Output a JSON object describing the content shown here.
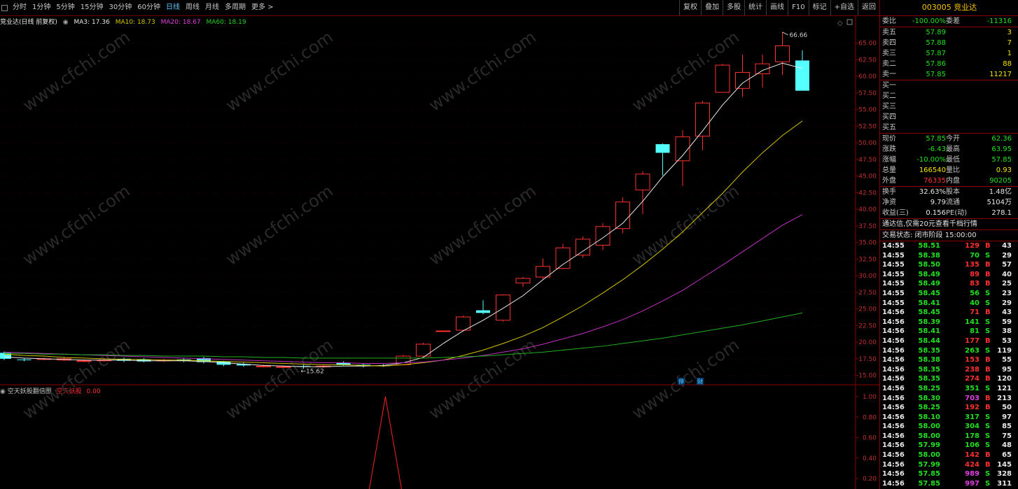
{
  "toolbar": {
    "tabs": [
      {
        "label": "分时",
        "active": false
      },
      {
        "label": "1分钟",
        "active": false
      },
      {
        "label": "5分钟",
        "active": false
      },
      {
        "label": "15分钟",
        "active": false
      },
      {
        "label": "30分钟",
        "active": false
      },
      {
        "label": "60分钟",
        "active": false
      },
      {
        "label": "日线",
        "active": true
      },
      {
        "label": "周线",
        "active": false
      },
      {
        "label": "月线",
        "active": false
      },
      {
        "label": "多周期",
        "active": false
      },
      {
        "label": "更多 >",
        "active": false
      }
    ],
    "right_buttons": [
      "复权",
      "叠加",
      "多股",
      "统计",
      "画线",
      "F10",
      "标记",
      "+自选",
      "返回"
    ]
  },
  "chart_header": {
    "name": "竞业达(日线 前复权)",
    "ma3": "MA3: 17.36",
    "ma10": "MA10: 18.73",
    "ma20": "MA20: 18.67",
    "ma60": "MA60: 18.19"
  },
  "indicator": {
    "title": "空天妖股翻倍图",
    "label": "空天妖股",
    "value": "0.00",
    "axis": [
      "1.00",
      "0.80",
      "0.60",
      "0.40",
      "0.20"
    ]
  },
  "price_axis": [
    "65.00",
    "62.50",
    "60.00",
    "57.50",
    "55.00",
    "52.50",
    "50.00",
    "47.50",
    "45.00",
    "42.50",
    "40.00",
    "37.50",
    "35.00",
    "32.50",
    "30.00",
    "27.50",
    "25.00",
    "22.50",
    "20.00",
    "17.50",
    "15.00"
  ],
  "annotations": {
    "high": "66.66",
    "low": "15.62",
    "event1": "停",
    "event2": "财"
  },
  "chart_data": {
    "type": "candlestick",
    "ylim": [
      13.8,
      67.5
    ],
    "candles": [
      {
        "o": 18.4,
        "c": 17.5,
        "h": 18.6,
        "l": 17.3
      },
      {
        "o": 17.4,
        "c": 17.3,
        "h": 17.6,
        "l": 17.1
      },
      {
        "o": 17.4,
        "c": 17.5,
        "h": 17.7,
        "l": 17.3
      },
      {
        "o": 17.3,
        "c": 17.5,
        "h": 17.8,
        "l": 17.2
      },
      {
        "o": 17.2,
        "c": 17.2,
        "h": 17.4,
        "l": 17.0
      },
      {
        "o": 17.3,
        "c": 17.3,
        "h": 17.6,
        "l": 17.1
      },
      {
        "o": 17.5,
        "c": 17.2,
        "h": 17.7,
        "l": 17.0
      },
      {
        "o": 17.4,
        "c": 17.1,
        "h": 17.6,
        "l": 17.0
      },
      {
        "o": 17.2,
        "c": 17.3,
        "h": 17.5,
        "l": 17.0
      },
      {
        "o": 17.4,
        "c": 17.2,
        "h": 17.6,
        "l": 17.0
      },
      {
        "o": 17.6,
        "c": 17.0,
        "h": 17.8,
        "l": 16.8
      },
      {
        "o": 17.1,
        "c": 16.6,
        "h": 17.2,
        "l": 16.4
      },
      {
        "o": 16.7,
        "c": 16.5,
        "h": 16.9,
        "l": 16.3
      },
      {
        "o": 16.4,
        "c": 16.4,
        "h": 16.6,
        "l": 16.2
      },
      {
        "o": 16.3,
        "c": 16.3,
        "h": 16.5,
        "l": 16.1
      },
      {
        "o": 16.4,
        "c": 16.3,
        "h": 16.6,
        "l": 16.0
      },
      {
        "o": 16.3,
        "c": 16.4,
        "h": 16.6,
        "l": 16.1
      },
      {
        "o": 16.9,
        "c": 16.6,
        "h": 17.1,
        "l": 16.5
      },
      {
        "o": 16.6,
        "c": 16.4,
        "h": 16.8,
        "l": 16.2
      },
      {
        "o": 16.5,
        "c": 16.4,
        "h": 16.7,
        "l": 16.3
      },
      {
        "o": 16.6,
        "c": 17.9,
        "h": 18.1,
        "l": 16.5
      },
      {
        "o": 17.9,
        "c": 19.7,
        "h": 19.9,
        "l": 17.8
      },
      {
        "o": 21.7,
        "c": 21.7,
        "h": 21.7,
        "l": 21.7
      },
      {
        "o": 21.8,
        "c": 23.8,
        "h": 24.0,
        "l": 21.6
      },
      {
        "o": 24.8,
        "c": 24.4,
        "h": 26.3,
        "l": 24.2
      },
      {
        "o": 23.3,
        "c": 27.1,
        "h": 27.2,
        "l": 23.1
      },
      {
        "o": 28.9,
        "c": 29.6,
        "h": 29.8,
        "l": 28.3
      },
      {
        "o": 29.8,
        "c": 31.4,
        "h": 32.6,
        "l": 29.5
      },
      {
        "o": 31.1,
        "c": 34.2,
        "h": 34.8,
        "l": 31.0
      },
      {
        "o": 33.1,
        "c": 35.5,
        "h": 35.9,
        "l": 32.7
      },
      {
        "o": 34.6,
        "c": 37.4,
        "h": 37.9,
        "l": 33.9
      },
      {
        "o": 37.1,
        "c": 41.1,
        "h": 41.8,
        "l": 36.4
      },
      {
        "o": 42.9,
        "c": 45.3,
        "h": 45.7,
        "l": 39.3
      },
      {
        "o": 49.8,
        "c": 48.5,
        "h": 49.9,
        "l": 45.1
      },
      {
        "o": 47.3,
        "c": 50.9,
        "h": 51.9,
        "l": 43.5
      },
      {
        "o": 51.0,
        "c": 56.0,
        "h": 56.3,
        "l": 48.9
      },
      {
        "o": 57.6,
        "c": 61.7,
        "h": 61.9,
        "l": 57.6
      },
      {
        "o": 58.2,
        "c": 60.6,
        "h": 63.3,
        "l": 56.9
      },
      {
        "o": 60.4,
        "c": 61.9,
        "h": 63.3,
        "l": 58.3
      },
      {
        "o": 62.2,
        "c": 64.6,
        "h": 66.66,
        "l": 60.2
      },
      {
        "o": 62.4,
        "c": 57.85,
        "h": 63.95,
        "l": 57.85
      }
    ],
    "ma": [
      {
        "name": "MA3",
        "color": "#e8e8e8",
        "values": [
          17.8,
          17.6,
          17.5,
          17.4,
          17.3,
          17.3,
          17.3,
          17.2,
          17.2,
          17.2,
          17.1,
          16.9,
          16.7,
          16.5,
          16.4,
          16.3,
          16.3,
          16.4,
          16.4,
          16.5,
          16.9,
          17.7,
          19.8,
          21.7,
          23.3,
          25.1,
          27.0,
          29.4,
          31.7,
          33.7,
          35.7,
          37.9,
          41.2,
          44.9,
          48.1,
          51.8,
          55.7,
          59.0,
          60.9,
          62.0,
          61.2
        ]
      },
      {
        "name": "MA10",
        "color": "#d4c400",
        "values": [
          18.2,
          18.0,
          17.9,
          17.7,
          17.6,
          17.5,
          17.4,
          17.4,
          17.3,
          17.3,
          17.2,
          17.1,
          17.0,
          16.9,
          16.8,
          16.7,
          16.6,
          16.6,
          16.5,
          16.4,
          16.6,
          16.9,
          17.3,
          18.0,
          18.8,
          19.8,
          20.9,
          22.2,
          23.8,
          25.5,
          27.4,
          29.4,
          31.6,
          34.0,
          36.6,
          39.5,
          42.4,
          45.6,
          48.5,
          51.1,
          53.3
        ]
      },
      {
        "name": "MA20",
        "color": "#c030c0",
        "values": [
          18.5,
          18.4,
          18.3,
          18.2,
          18.1,
          18.0,
          17.9,
          17.8,
          17.7,
          17.6,
          17.5,
          17.4,
          17.3,
          17.2,
          17.1,
          17.0,
          16.9,
          16.9,
          16.8,
          16.8,
          16.9,
          17.0,
          17.3,
          17.6,
          18.0,
          18.5,
          19.0,
          19.7,
          20.5,
          21.3,
          22.3,
          23.4,
          24.7,
          26.2,
          27.8,
          29.7,
          31.6,
          33.6,
          35.6,
          37.6,
          39.2
        ]
      },
      {
        "name": "MA60",
        "color": "#20b020",
        "values": [
          18.3,
          18.3,
          18.2,
          18.2,
          18.1,
          18.1,
          18.0,
          18.0,
          17.9,
          17.9,
          17.9,
          17.8,
          17.8,
          17.7,
          17.7,
          17.6,
          17.6,
          17.6,
          17.6,
          17.6,
          17.6,
          17.6,
          17.7,
          17.8,
          17.9,
          18.1,
          18.3,
          18.5,
          18.8,
          19.1,
          19.4,
          19.8,
          20.2,
          20.6,
          21.1,
          21.6,
          22.1,
          22.6,
          23.2,
          23.8,
          24.4
        ]
      }
    ]
  },
  "quote_panel": {
    "title": "003005 竞业达",
    "weibi": {
      "label": "委比",
      "value": "-100.00%",
      "label2": "委差",
      "value2": "-11316"
    },
    "asks": [
      {
        "label": "卖五",
        "price": "57.89",
        "vol": "3"
      },
      {
        "label": "卖四",
        "price": "57.88",
        "vol": "7"
      },
      {
        "label": "卖三",
        "price": "57.87",
        "vol": "1"
      },
      {
        "label": "卖二",
        "price": "57.86",
        "vol": "88"
      },
      {
        "label": "卖一",
        "price": "57.85",
        "vol": "11217"
      }
    ],
    "bids": [
      "买一",
      "买二",
      "买三",
      "买四",
      "买五"
    ],
    "stats": [
      {
        "l1": "现价",
        "v1": "57.85",
        "c1": "green",
        "l2": "今开",
        "v2": "62.36",
        "c2": "green"
      },
      {
        "l1": "涨跌",
        "v1": "-6.43",
        "c1": "green",
        "l2": "最高",
        "v2": "63.95",
        "c2": "green"
      },
      {
        "l1": "涨幅",
        "v1": "-10.00%",
        "c1": "green",
        "l2": "最低",
        "v2": "57.85",
        "c2": "green"
      },
      {
        "l1": "总量",
        "v1": "166540",
        "c1": "yellow",
        "l2": "量比",
        "v2": "0.93",
        "c2": "yellow"
      },
      {
        "l1": "外盘",
        "v1": "76335",
        "c1": "red",
        "l2": "内盘",
        "v2": "90205",
        "c2": "green"
      }
    ],
    "stats2": [
      {
        "l1": "换手",
        "v1": "32.63%",
        "l2": "股本",
        "v2": "1.48亿"
      },
      {
        "l1": "净资",
        "v1": "9.79",
        "l2": "流通",
        "v2": "5104万"
      },
      {
        "l1": "收益(三)",
        "v1": "0.156",
        "l2": "PE(动)",
        "v2": "278.1"
      }
    ],
    "notice": "通达信,仅需20元查看千档行情",
    "trade_status": "交易状态: 闭市阶段 15:00:00"
  },
  "ticks": [
    {
      "t": "14:55",
      "p": "58.51",
      "v": "129",
      "s": "B",
      "n": "43"
    },
    {
      "t": "14:55",
      "p": "58.38",
      "v": "70",
      "s": "S",
      "n": "29"
    },
    {
      "t": "14:55",
      "p": "58.50",
      "v": "135",
      "s": "B",
      "n": "57"
    },
    {
      "t": "14:55",
      "p": "58.49",
      "v": "89",
      "s": "B",
      "n": "40"
    },
    {
      "t": "14:55",
      "p": "58.49",
      "v": "83",
      "s": "B",
      "n": "25"
    },
    {
      "t": "14:55",
      "p": "58.45",
      "v": "56",
      "s": "S",
      "n": "23"
    },
    {
      "t": "14:55",
      "p": "58.41",
      "v": "40",
      "s": "S",
      "n": "29"
    },
    {
      "t": "14:56",
      "p": "58.45",
      "v": "71",
      "s": "B",
      "n": "43"
    },
    {
      "t": "14:56",
      "p": "58.39",
      "v": "141",
      "s": "S",
      "n": "59"
    },
    {
      "t": "14:56",
      "p": "58.41",
      "v": "81",
      "s": "S",
      "n": "38"
    },
    {
      "t": "14:56",
      "p": "58.44",
      "v": "177",
      "s": "B",
      "n": "53"
    },
    {
      "t": "14:56",
      "p": "58.35",
      "v": "263",
      "s": "S",
      "n": "119"
    },
    {
      "t": "14:56",
      "p": "58.38",
      "v": "153",
      "s": "B",
      "n": "55"
    },
    {
      "t": "14:56",
      "p": "58.35",
      "v": "238",
      "s": "B",
      "n": "95"
    },
    {
      "t": "14:56",
      "p": "58.35",
      "v": "274",
      "s": "B",
      "n": "120"
    },
    {
      "t": "14:56",
      "p": "58.25",
      "v": "351",
      "s": "S",
      "n": "121"
    },
    {
      "t": "14:56",
      "p": "58.30",
      "v": "703",
      "s": "B",
      "n": "213"
    },
    {
      "t": "14:56",
      "p": "58.25",
      "v": "192",
      "s": "B",
      "n": "50"
    },
    {
      "t": "14:56",
      "p": "58.10",
      "v": "317",
      "s": "S",
      "n": "97"
    },
    {
      "t": "14:56",
      "p": "58.00",
      "v": "304",
      "s": "S",
      "n": "85"
    },
    {
      "t": "14:56",
      "p": "58.00",
      "v": "178",
      "s": "S",
      "n": "75"
    },
    {
      "t": "14:56",
      "p": "57.99",
      "v": "106",
      "s": "S",
      "n": "48"
    },
    {
      "t": "14:56",
      "p": "58.00",
      "v": "142",
      "s": "B",
      "n": "65"
    },
    {
      "t": "14:56",
      "p": "57.99",
      "v": "424",
      "s": "B",
      "n": "145"
    },
    {
      "t": "14:56",
      "p": "57.85",
      "v": "989",
      "s": "S",
      "n": "328"
    },
    {
      "t": "14:56",
      "p": "57.85",
      "v": "997",
      "s": "S",
      "n": "311"
    }
  ],
  "watermark": "www.cfchi.com"
}
